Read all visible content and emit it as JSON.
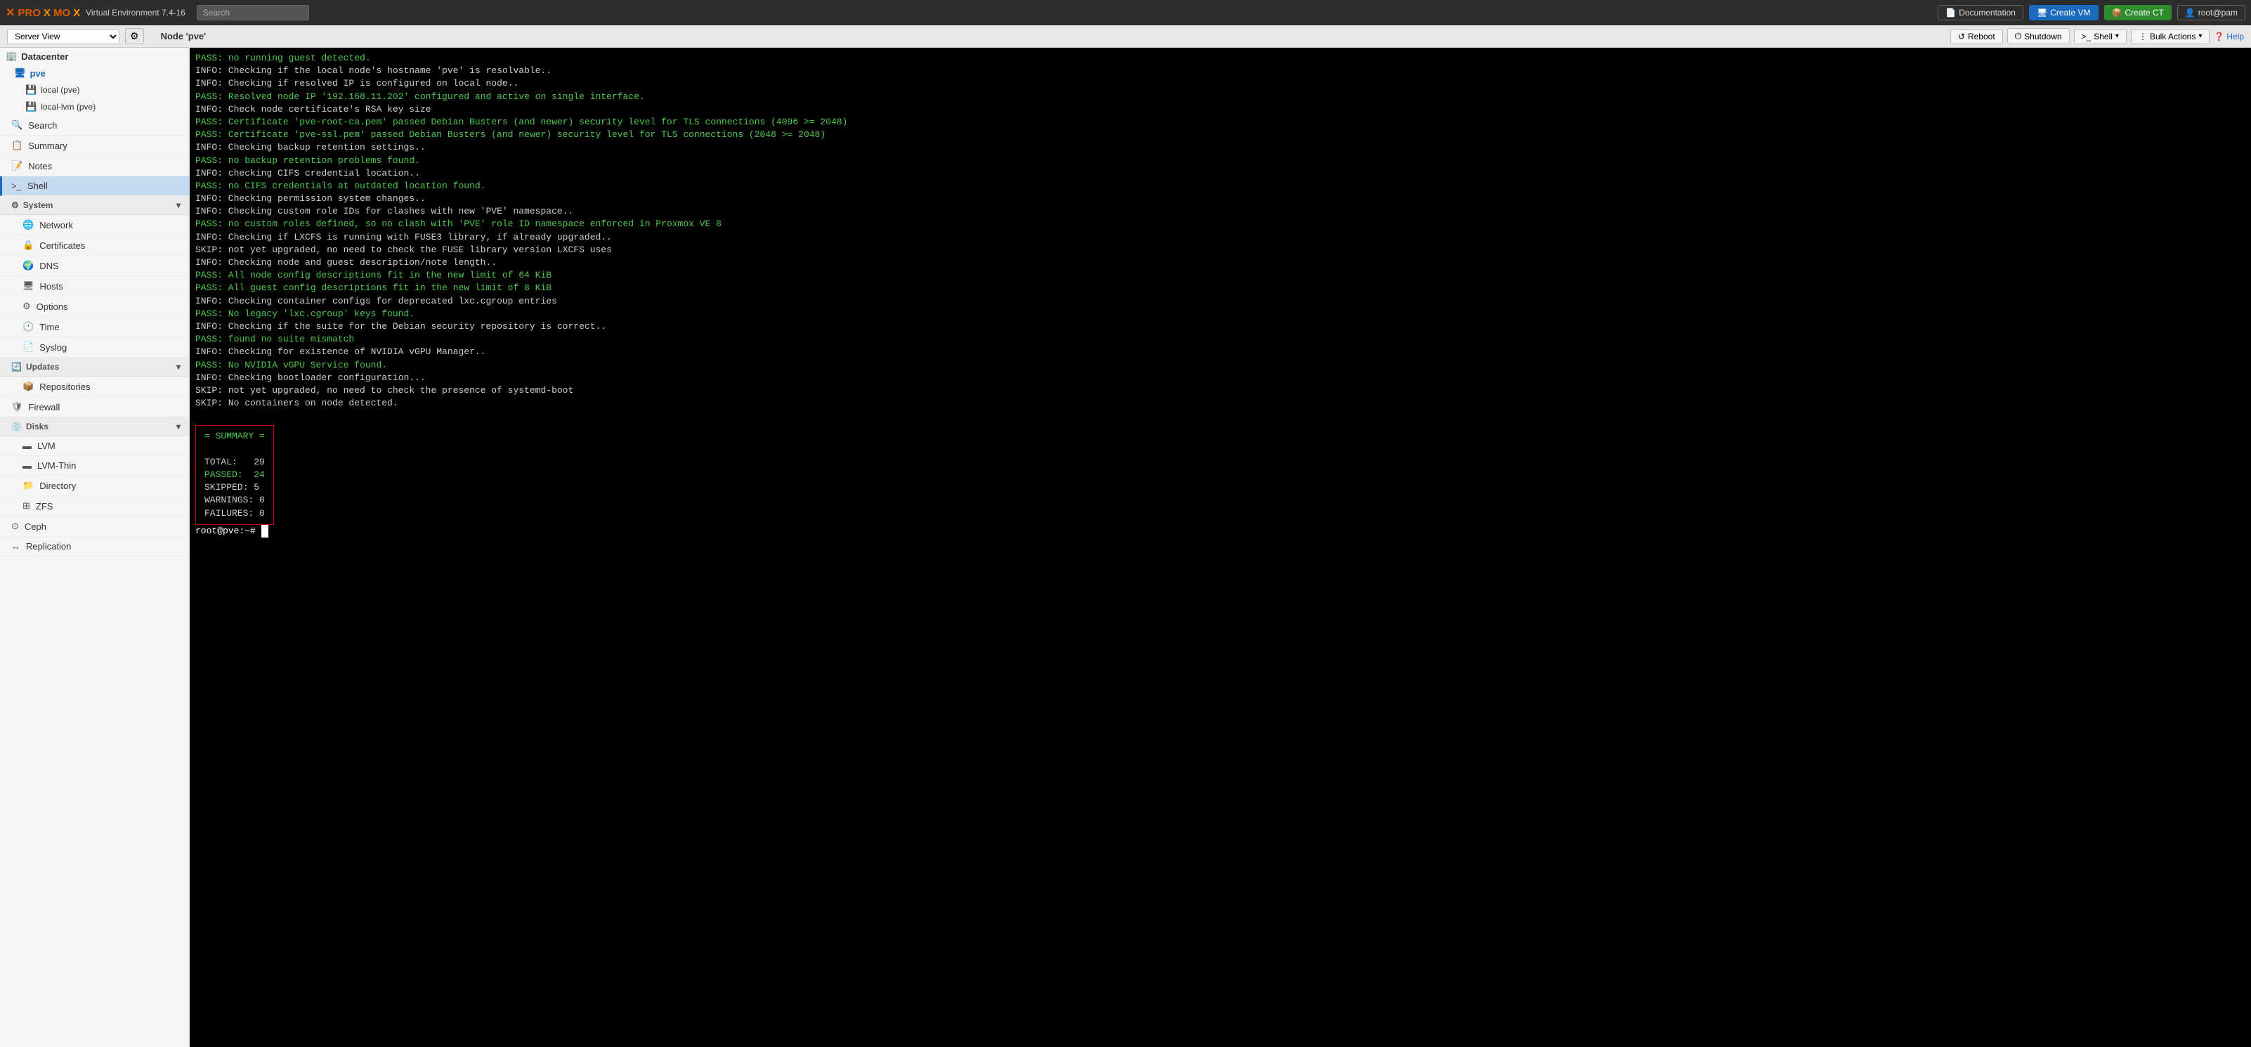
{
  "topbar": {
    "logo_prox": "PRO",
    "logo_x": "X",
    "logo_mo": "MO",
    "logo_x2": "X",
    "version": "Virtual Environment 7.4-16",
    "search_placeholder": "Search",
    "doc_label": "Documentation",
    "create_vm_label": "Create VM",
    "create_ct_label": "Create CT",
    "user_label": "root@pam"
  },
  "subbar": {
    "server_view_label": "Server View",
    "node_title": "Node 'pve'",
    "reboot_label": "Reboot",
    "shutdown_label": "Shutdown",
    "shell_label": "Shell",
    "bulk_actions_label": "Bulk Actions",
    "help_label": "Help"
  },
  "sidebar": {
    "datacenter_label": "Datacenter",
    "pve_label": "pve",
    "local_label": "local (pve)",
    "local_lvm_label": "local-lvm (pve)"
  },
  "nav": {
    "search_label": "Search",
    "summary_label": "Summary",
    "notes_label": "Notes",
    "shell_label": "Shell",
    "system_label": "System",
    "network_label": "Network",
    "certificates_label": "Certificates",
    "dns_label": "DNS",
    "hosts_label": "Hosts",
    "options_label": "Options",
    "time_label": "Time",
    "syslog_label": "Syslog",
    "updates_label": "Updates",
    "repositories_label": "Repositories",
    "firewall_label": "Firewall",
    "disks_label": "Disks",
    "lvm_label": "LVM",
    "lvm_thin_label": "LVM-Thin",
    "directory_label": "Directory",
    "zfs_label": "ZFS",
    "ceph_label": "Ceph",
    "replication_label": "Replication"
  },
  "terminal": {
    "lines": [
      {
        "type": "pass",
        "text": "PASS: no running guest detected."
      },
      {
        "type": "info",
        "text": "INFO: Checking if the local node's hostname 'pve' is resolvable.."
      },
      {
        "type": "info",
        "text": "INFO: Checking if resolved IP is configured on local node.."
      },
      {
        "type": "pass",
        "text": "PASS: Resolved node IP '192.168.11.202' configured and active on single interface."
      },
      {
        "type": "info",
        "text": "INFO: Check node certificate's RSA key size"
      },
      {
        "type": "pass",
        "text": "PASS: Certificate 'pve-root-ca.pem' passed Debian Busters (and newer) security level for TLS connections (4096 >= 2048)"
      },
      {
        "type": "pass",
        "text": "PASS: Certificate 'pve-ssl.pem' passed Debian Busters (and newer) security level for TLS connections (2048 >= 2048)"
      },
      {
        "type": "info",
        "text": "INFO: Checking backup retention settings.."
      },
      {
        "type": "pass",
        "text": "PASS: no backup retention problems found."
      },
      {
        "type": "info",
        "text": "INFO: checking CIFS credential location.."
      },
      {
        "type": "pass",
        "text": "PASS: no CIFS credentials at outdated location found."
      },
      {
        "type": "info",
        "text": "INFO: Checking permission system changes.."
      },
      {
        "type": "info",
        "text": "INFO: Checking custom role IDs for clashes with new 'PVE' namespace.."
      },
      {
        "type": "pass",
        "text": "PASS: no custom roles defined, so no clash with 'PVE' role ID namespace enforced in Proxmox VE 8"
      },
      {
        "type": "info",
        "text": "INFO: Checking if LXCFS is running with FUSE3 library, if already upgraded.."
      },
      {
        "type": "skip",
        "text": "SKIP: not yet upgraded, no need to check the FUSE library version LXCFS uses"
      },
      {
        "type": "info",
        "text": "INFO: Checking node and guest description/note length.."
      },
      {
        "type": "pass",
        "text": "PASS: All node config descriptions fit in the new limit of 64 KiB"
      },
      {
        "type": "pass",
        "text": "PASS: All guest config descriptions fit in the new limit of 8 KiB"
      },
      {
        "type": "info",
        "text": "INFO: Checking container configs for deprecated lxc.cgroup entries"
      },
      {
        "type": "pass",
        "text": "PASS: No legacy 'lxc.cgroup' keys found."
      },
      {
        "type": "info",
        "text": "INFO: Checking if the suite for the Debian security repository is correct.."
      },
      {
        "type": "pass",
        "text": "PASS: found no suite mismatch"
      },
      {
        "type": "info",
        "text": "INFO: Checking for existence of NVIDIA vGPU Manager.."
      },
      {
        "type": "pass",
        "text": "PASS: No NVIDIA vGPU Service found."
      },
      {
        "type": "info",
        "text": "INFO: Checking bootloader configuration..."
      },
      {
        "type": "skip",
        "text": "SKIP: not yet upgraded, no need to check the presence of systemd-boot"
      },
      {
        "type": "skip",
        "text": "SKIP: No containers on node detected."
      }
    ],
    "summary": {
      "title": "= SUMMARY =",
      "total_label": "TOTAL:",
      "total_val": "29",
      "passed_label": "PASSED:",
      "passed_val": "24",
      "skipped_label": "SKIPPED:",
      "skipped_val": "5",
      "warnings_label": "WARNINGS:",
      "warnings_val": "0",
      "failures_label": "FAILURES:",
      "failures_val": "0"
    },
    "prompt": "root@pve:~#"
  }
}
